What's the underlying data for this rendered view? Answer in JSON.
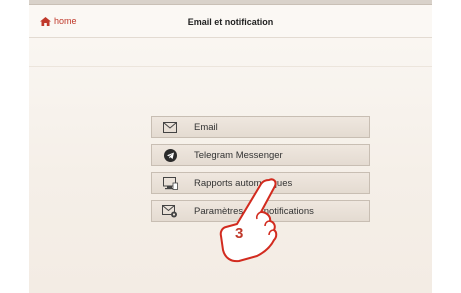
{
  "header": {
    "home_label": "home",
    "title": "Email et notification"
  },
  "menu": {
    "items": [
      {
        "label": "Email",
        "icon": "envelope-icon"
      },
      {
        "label": "Telegram Messenger",
        "icon": "telegram-icon"
      },
      {
        "label": "Rapports automatiques",
        "icon": "monitor-report-icon"
      },
      {
        "label": "Paramètres des notifications",
        "icon": "envelope-gear-icon"
      }
    ]
  },
  "annotation": {
    "step_number": "3"
  },
  "colors": {
    "accent": "#c0392b",
    "button_bg": "#e9e0d6",
    "button_border": "#c8beb3"
  }
}
